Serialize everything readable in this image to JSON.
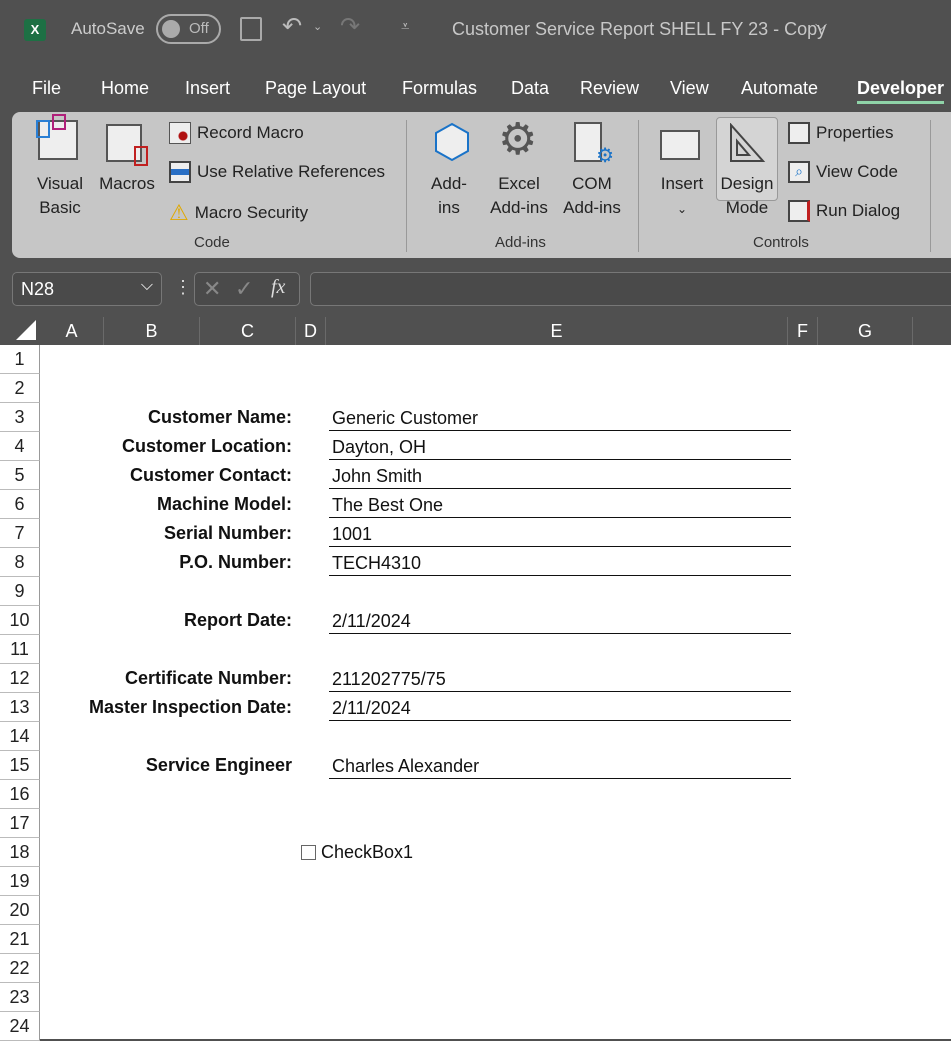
{
  "titlebar": {
    "app_icon": "excel-icon",
    "autosave_label": "AutoSave",
    "autosave_state": "Off",
    "doc_title": "Customer Service Report SHELL FY 23 - Copy"
  },
  "tabs": [
    "File",
    "Home",
    "Insert",
    "Page Layout",
    "Formulas",
    "Data",
    "Review",
    "View",
    "Automate",
    "Developer"
  ],
  "active_tab": "Developer",
  "ribbon": {
    "code": {
      "visual_basic": "Visual Basic",
      "macros": "Macros",
      "record_macro": "Record Macro",
      "relative_refs": "Use Relative References",
      "macro_security": "Macro Security",
      "group": "Code"
    },
    "addins": {
      "addins": "Add-ins",
      "excel_addins": "Excel Add-ins",
      "com_addins": "COM Add-ins",
      "group": "Add-ins"
    },
    "controls": {
      "insert": "Insert",
      "design_mode": "Design Mode",
      "properties": "Properties",
      "view_code": "View Code",
      "run_dialog": "Run Dialog",
      "group": "Controls"
    }
  },
  "formula_bar": {
    "name_box": "N28",
    "formula": ""
  },
  "columns": [
    "A",
    "B",
    "C",
    "D",
    "E",
    "F",
    "G"
  ],
  "rows": [
    "1",
    "2",
    "3",
    "4",
    "5",
    "6",
    "7",
    "8",
    "9",
    "10",
    "11",
    "12",
    "13",
    "14",
    "15",
    "16",
    "17",
    "18",
    "19",
    "20",
    "21",
    "22",
    "23",
    "24"
  ],
  "form": [
    {
      "row": 3,
      "label": "Customer Name:",
      "value": "Generic Customer"
    },
    {
      "row": 4,
      "label": "Customer Location:",
      "value": "Dayton, OH"
    },
    {
      "row": 5,
      "label": "Customer Contact:",
      "value": "John Smith"
    },
    {
      "row": 6,
      "label": "Machine Model:",
      "value": "The Best One"
    },
    {
      "row": 7,
      "label": "Serial Number:",
      "value": "1001"
    },
    {
      "row": 8,
      "label": "P.O. Number:",
      "value": "TECH4310"
    },
    {
      "row": 10,
      "label": "Report Date:",
      "value": "2/11/2024"
    },
    {
      "row": 12,
      "label": "Certificate Number:",
      "value": "211202775/75"
    },
    {
      "row": 13,
      "label": "Master Inspection Date:",
      "value": "2/11/2024"
    },
    {
      "row": 15,
      "label": "Service Engineer",
      "value": "Charles Alexander"
    }
  ],
  "checkbox": {
    "label": "CheckBox1",
    "checked": false
  }
}
